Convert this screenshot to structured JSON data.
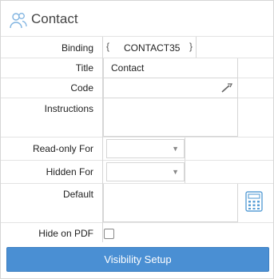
{
  "header": {
    "title": "Contact",
    "icon": "contact-group-icon"
  },
  "fields": {
    "binding": {
      "label": "Binding",
      "value": "CONTACT35",
      "open_brace": "{",
      "close_brace": "}"
    },
    "title": {
      "label": "Title",
      "value": "Contact"
    },
    "code": {
      "label": "Code",
      "value": "",
      "icon": "edit-wand-icon"
    },
    "instructions": {
      "label": "Instructions",
      "value": ""
    },
    "read_only_for": {
      "label": "Read-only For",
      "selected": ""
    },
    "hidden_for": {
      "label": "Hidden For",
      "selected": ""
    },
    "default": {
      "label": "Default",
      "value": "",
      "icon": "calculator-icon"
    },
    "hide_on_pdf": {
      "label": "Hide on PDF",
      "checked": false
    }
  },
  "actions": {
    "visibility_setup_label": "Visibility Setup"
  },
  "colors": {
    "button": "#4a8fd3",
    "icon_accent": "#5a9fd6"
  }
}
